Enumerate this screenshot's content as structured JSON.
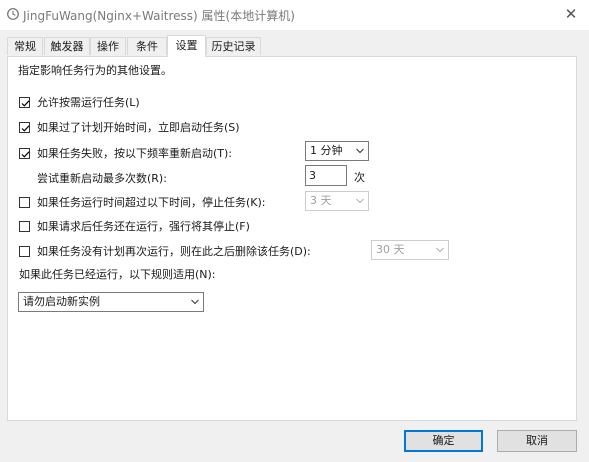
{
  "window": {
    "title": "JingFuWang(Nginx+Waitress) 属性(本地计算机)",
    "close_glyph": "✕"
  },
  "tabs": [
    {
      "label": "常规",
      "active": false
    },
    {
      "label": "触发器",
      "active": false
    },
    {
      "label": "操作",
      "active": false
    },
    {
      "label": "条件",
      "active": false
    },
    {
      "label": "设置",
      "active": true
    },
    {
      "label": "历史记录",
      "active": false
    }
  ],
  "settings": {
    "description": "指定影响任务行为的其他设置。",
    "allow_on_demand": {
      "label": "允许按需运行任务(L)",
      "checked": true
    },
    "run_after_missed": {
      "label": "如果过了计划开始时间，立即启动任务(S)",
      "checked": true
    },
    "restart_on_fail": {
      "label": "如果任务失败，按以下频率重新启动(T):",
      "checked": true,
      "interval": "1 分钟"
    },
    "restart_attempts": {
      "label": "尝试重新启动最多次数(R):",
      "value": "3",
      "unit": "次"
    },
    "stop_if_runs_longer": {
      "label": "如果任务运行时间超过以下时间，停止任务(K):",
      "checked": false,
      "duration": "3 天"
    },
    "force_stop": {
      "label": "如果请求后任务还在运行，强行将其停止(F)",
      "checked": false
    },
    "delete_if_not_scheduled": {
      "label": "如果任务没有计划再次运行，则在此之后删除该任务(D):",
      "checked": false,
      "duration": "30 天"
    },
    "already_running": {
      "label": "如果此任务已经运行，以下规则适用(N):",
      "rule": "请勿启动新实例"
    }
  },
  "buttons": {
    "ok": "确定",
    "cancel": "取消"
  },
  "colors": {
    "check_mark": "#000000",
    "primary_border": "#0078d7"
  }
}
